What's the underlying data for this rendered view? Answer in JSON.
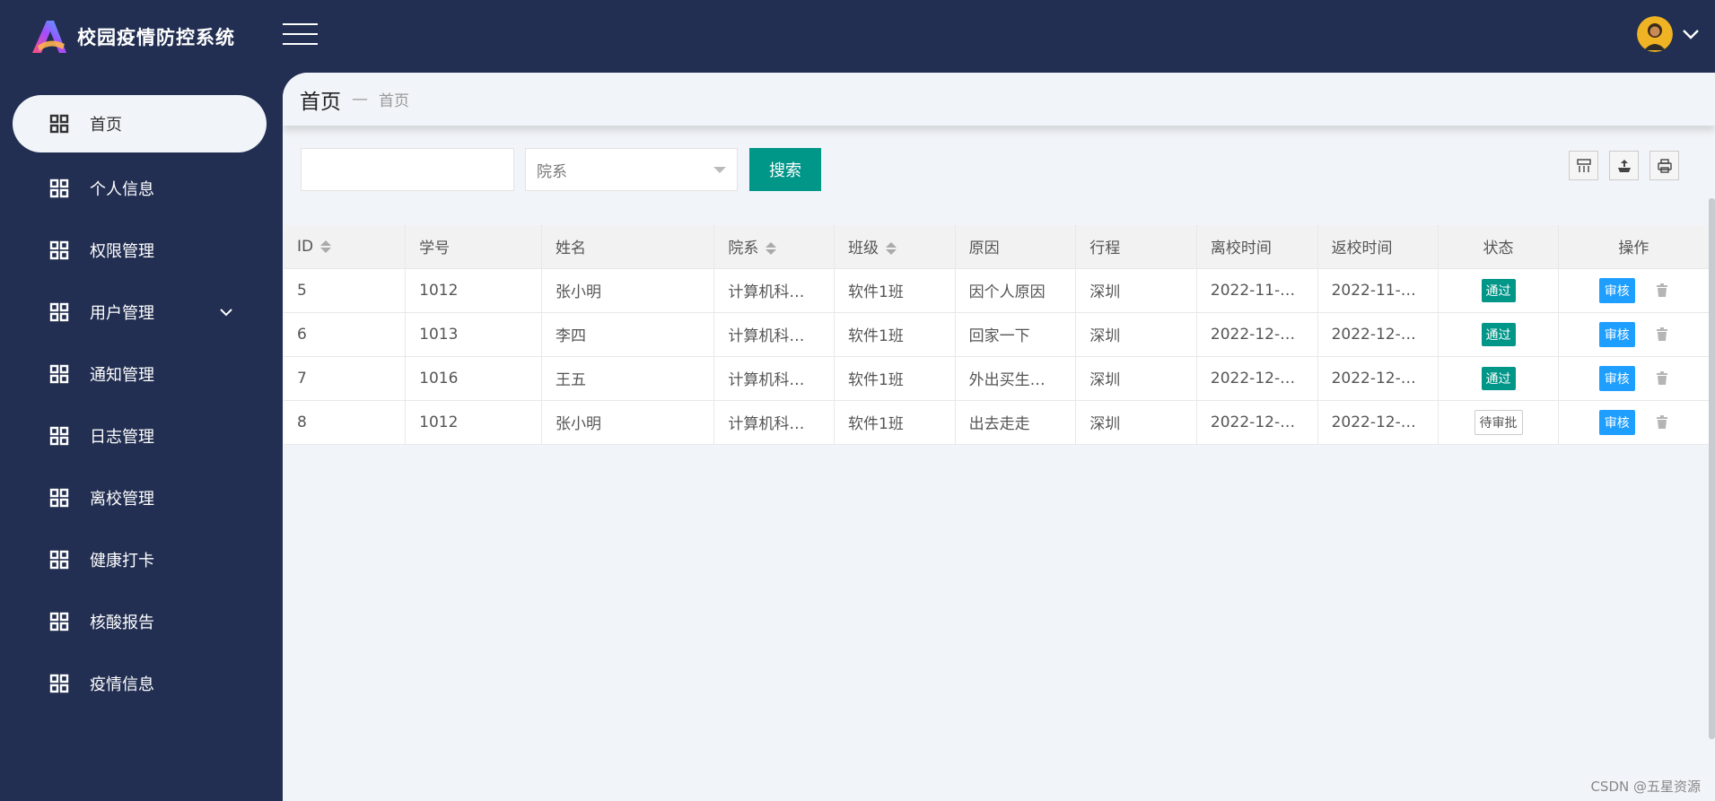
{
  "app": {
    "title": "校园疫情防控系统"
  },
  "sidebar": {
    "items": [
      {
        "label": "首页"
      },
      {
        "label": "个人信息"
      },
      {
        "label": "权限管理"
      },
      {
        "label": "用户管理"
      },
      {
        "label": "通知管理"
      },
      {
        "label": "日志管理"
      },
      {
        "label": "离校管理"
      },
      {
        "label": "健康打卡"
      },
      {
        "label": "核酸报告"
      },
      {
        "label": "疫情信息"
      }
    ]
  },
  "breadcrumb": {
    "main": "首页",
    "sep": "—",
    "sub": "首页"
  },
  "search": {
    "placeholder": "",
    "dept_placeholder": "院系",
    "button": "搜索"
  },
  "table": {
    "headers": [
      "ID",
      "学号",
      "姓名",
      "院系",
      "班级",
      "原因",
      "行程",
      "离校时间",
      "返校时间",
      "状态",
      "操作"
    ],
    "rows": [
      {
        "id": "5",
        "sno": "1012",
        "name": "张小明",
        "dept": "计算机科…",
        "cls": "软件1班",
        "reason": "因个人原因",
        "trip": "深圳",
        "leave": "2022-11-…",
        "back": "2022-11-…",
        "status": "通过",
        "action": "审核"
      },
      {
        "id": "6",
        "sno": "1013",
        "name": "李四",
        "dept": "计算机科…",
        "cls": "软件1班",
        "reason": "回家一下",
        "trip": "深圳",
        "leave": "2022-12-…",
        "back": "2022-12-…",
        "status": "通过",
        "action": "审核"
      },
      {
        "id": "7",
        "sno": "1016",
        "name": "王五",
        "dept": "计算机科…",
        "cls": "软件1班",
        "reason": "外出买生…",
        "trip": "深圳",
        "leave": "2022-12-…",
        "back": "2022-12-…",
        "status": "通过",
        "action": "审核"
      },
      {
        "id": "8",
        "sno": "1012",
        "name": "张小明",
        "dept": "计算机科…",
        "cls": "软件1班",
        "reason": "出去走走",
        "trip": "深圳",
        "leave": "2022-12-…",
        "back": "2022-12-…",
        "status": "待审批",
        "action": "审核"
      }
    ]
  },
  "watermark": "CSDN @五星资源",
  "colors": {
    "sidebar": "#222f52",
    "primary": "#009688",
    "audit": "#1e9fff",
    "content_bg": "#f1f4f8"
  }
}
